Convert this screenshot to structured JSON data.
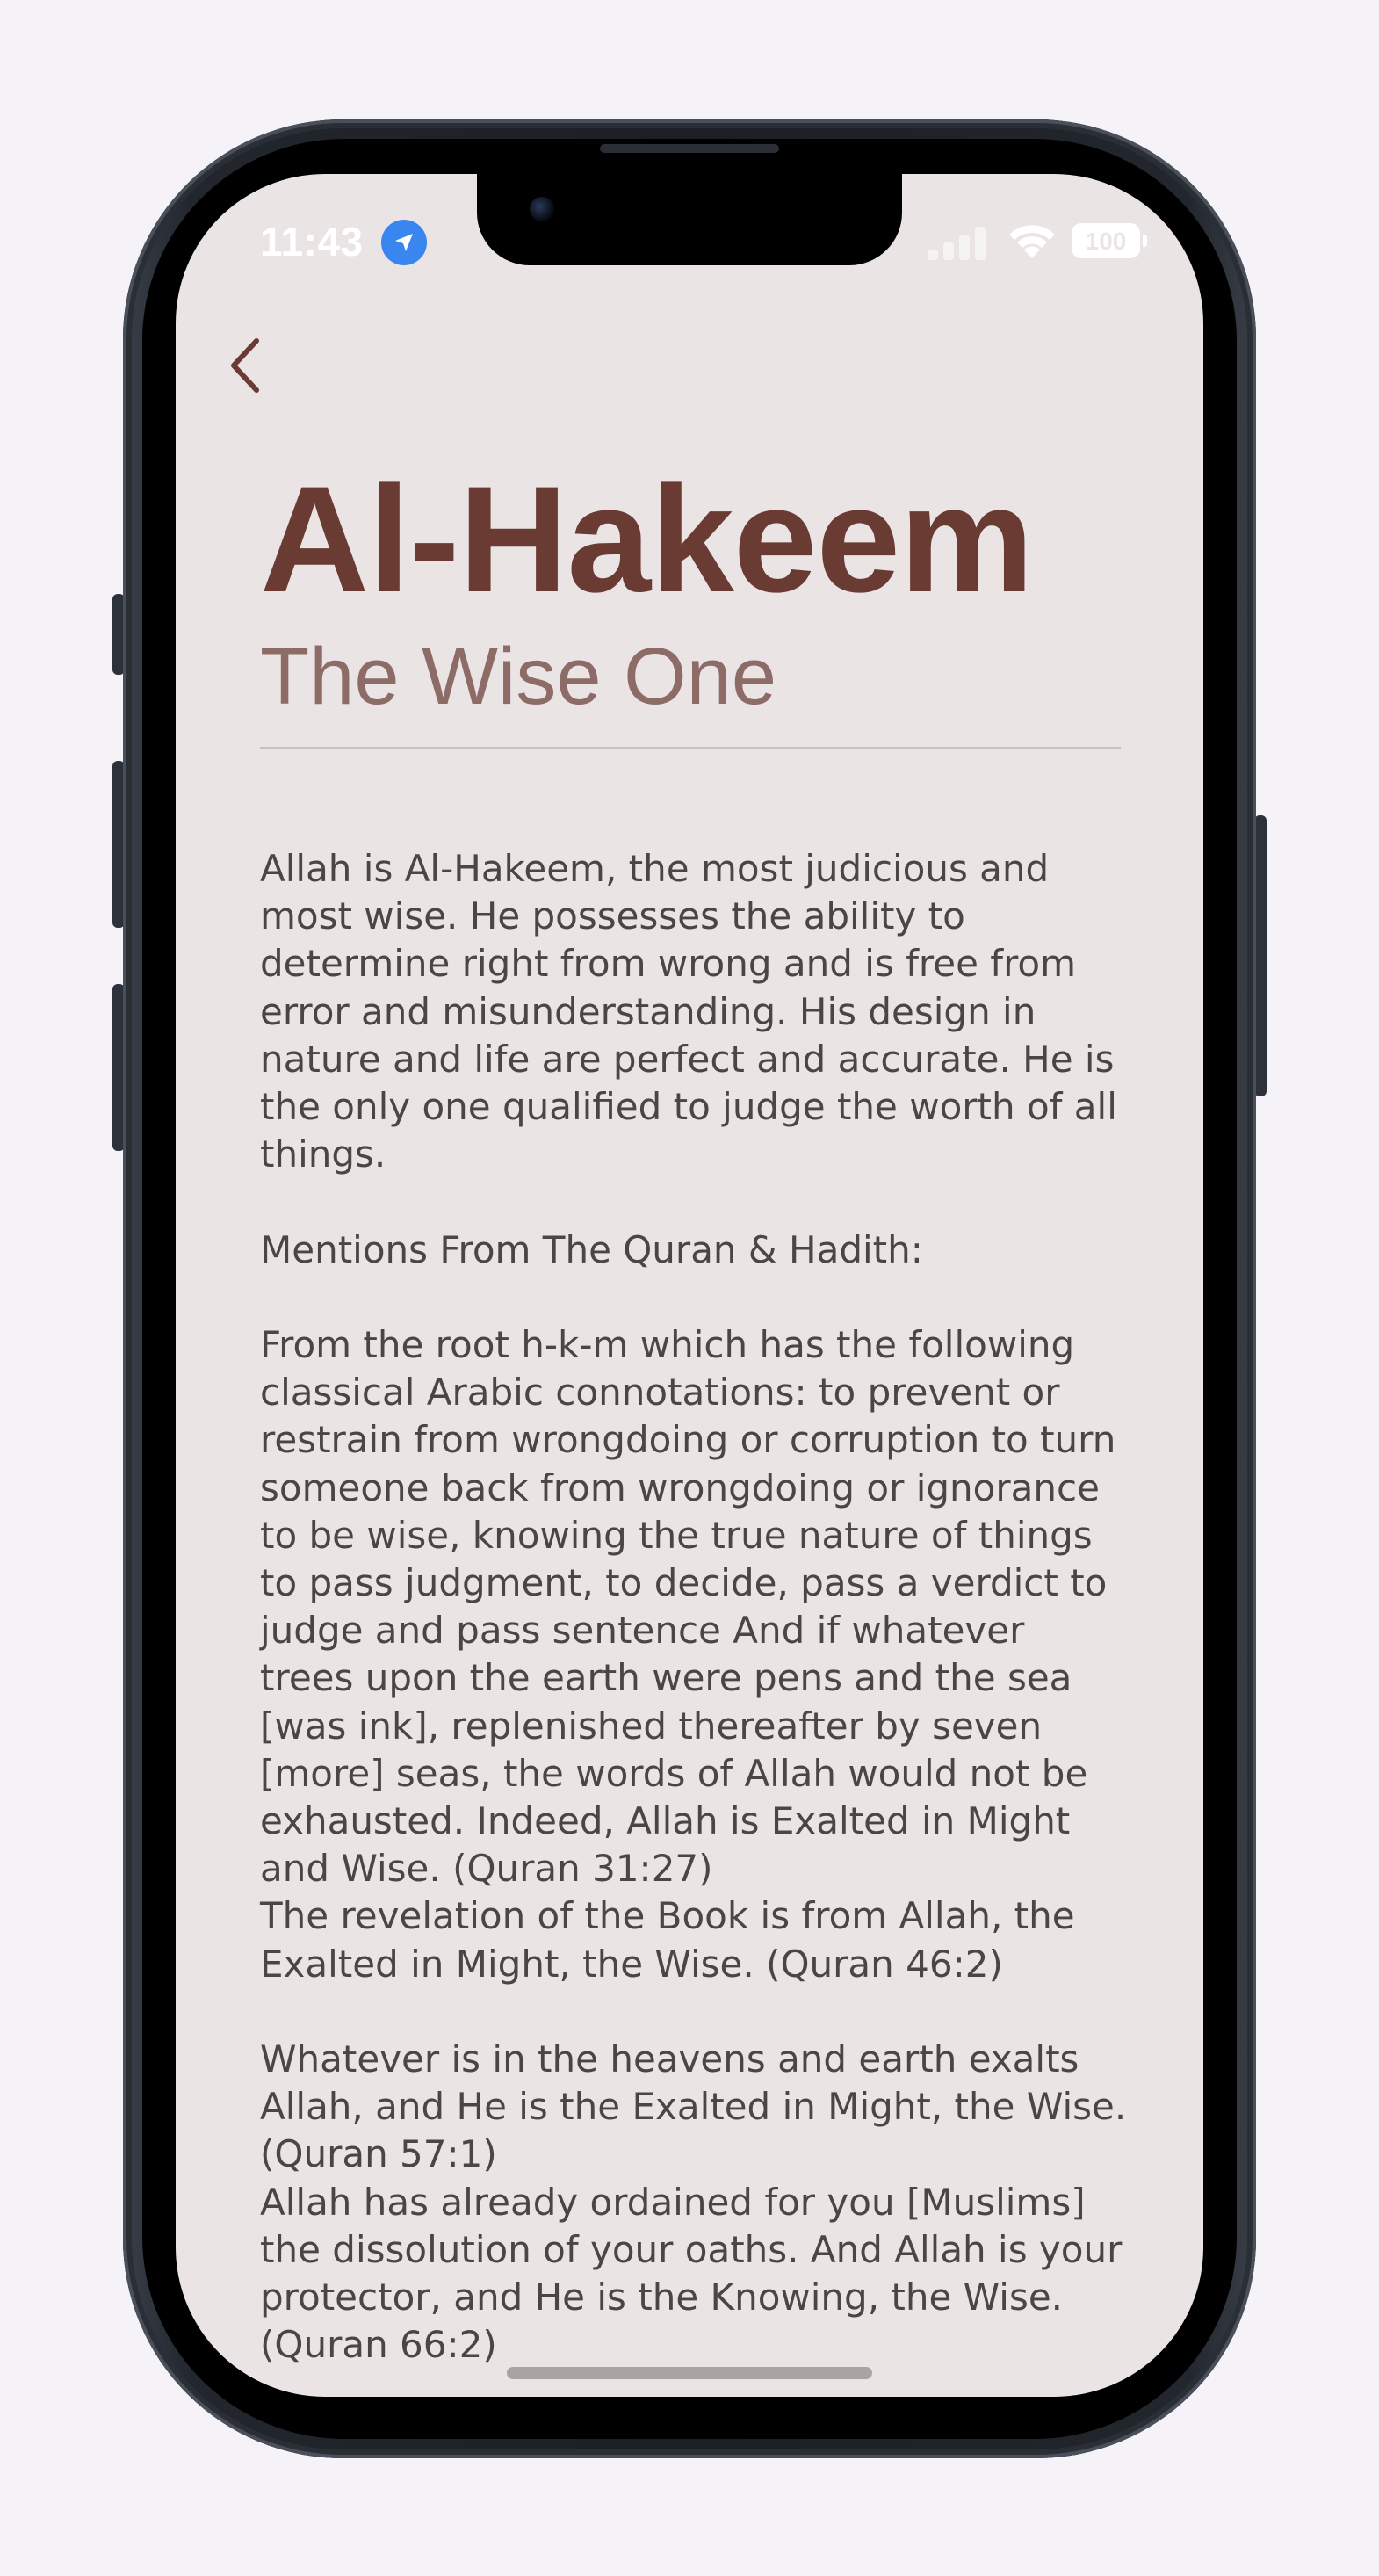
{
  "status_bar": {
    "time": "11:43",
    "battery": "100"
  },
  "navigation": {
    "back_icon": "chevron-left-icon"
  },
  "header": {
    "title": "Al-Hakeem",
    "subtitle": "The Wise One"
  },
  "body": {
    "text": "Allah is Al-Hakeem, the most judicious and most wise. He possesses the ability to determine right from wrong and is free from error and misunderstanding. His design in nature and life are perfect and accurate. He is the only one qualified to judge the worth of all things.\n\nMentions From The Quran & Hadith:\n\nFrom the root h-k-m which has the following classical Arabic connotations: to prevent or restrain from wrongdoing or corruption to turn someone back from wrongdoing or ignorance to be wise, knowing the true nature of things to pass judgment, to decide, pass a verdict to judge and pass sentence And if whatever trees upon the earth were pens and the sea [was ink], replenished thereafter by seven [more] seas, the words of Allah would not be exhausted. Indeed, Allah is Exalted in Might and Wise. (Quran 31:27)\nThe revelation of the Book is from Allah, the Exalted in Might, the Wise. (Quran 46:2)\n\nWhatever is in the heavens and earth exalts Allah, and He is the Exalted in Might, the Wise. (Quran 57:1)\nAllah has already ordained for you [Muslims] the dissolution of your oaths. And Allah is your protector, and He is the Knowing, the Wise. (Quran 66:2)"
  },
  "colors": {
    "background": "#ebe4e5",
    "title": "#6a3b33",
    "subtitle": "#8d6c68",
    "body_text": "#4b4546",
    "location_badge": "#3a86f0"
  }
}
